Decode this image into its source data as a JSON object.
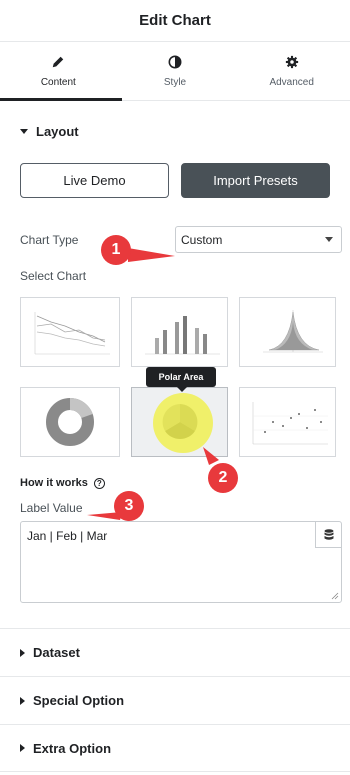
{
  "header": {
    "title": "Edit Chart"
  },
  "tabs": [
    {
      "label": "Content",
      "icon": "pencil-icon",
      "active": true
    },
    {
      "label": "Style",
      "icon": "contrast-icon",
      "active": false
    },
    {
      "label": "Advanced",
      "icon": "gear-icon",
      "active": false
    }
  ],
  "layout": {
    "title": "Layout",
    "live_demo_label": "Live Demo",
    "import_presets_label": "Import Presets",
    "chart_type_label": "Chart Type",
    "chart_type_value": "Custom",
    "select_chart_label": "Select Chart",
    "charts": [
      "line-chart",
      "bar-chart",
      "radar-chart",
      "doughnut-chart",
      "polar-area-chart",
      "scatter-chart"
    ],
    "tooltip": "Polar Area",
    "how_it_works": "How it works",
    "label_value_label": "Label Value",
    "label_value_text": "Jan | Feb | Mar"
  },
  "sections": [
    {
      "title": "Dataset"
    },
    {
      "title": "Special Option"
    },
    {
      "title": "Extra Option"
    }
  ],
  "markers": [
    "1",
    "2",
    "3"
  ],
  "colors": {
    "accent": "#495157",
    "marker": "#e8393c",
    "highlight": "#f0f03c"
  }
}
